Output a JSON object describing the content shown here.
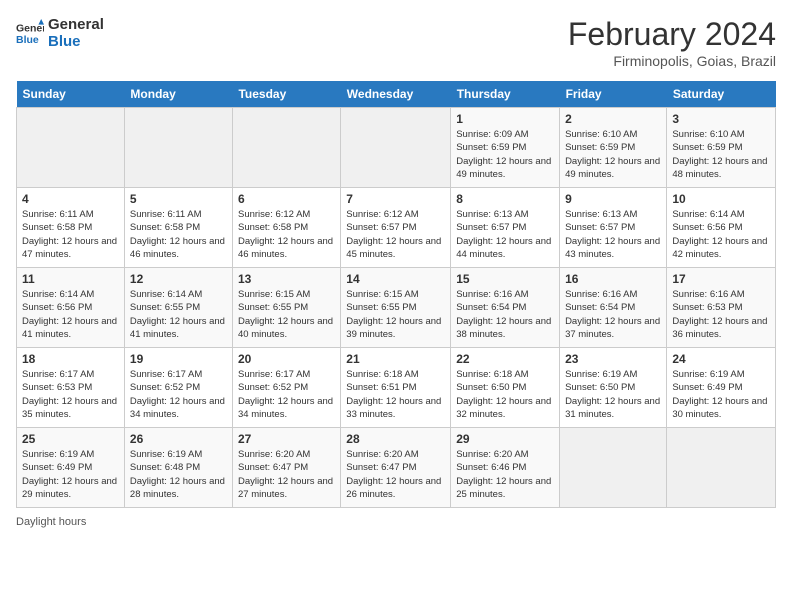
{
  "header": {
    "logo_general": "General",
    "logo_blue": "Blue",
    "month_title": "February 2024",
    "location": "Firminopolis, Goias, Brazil"
  },
  "days_of_week": [
    "Sunday",
    "Monday",
    "Tuesday",
    "Wednesday",
    "Thursday",
    "Friday",
    "Saturday"
  ],
  "weeks": [
    [
      {
        "day": "",
        "sunrise": "",
        "sunset": "",
        "daylight": ""
      },
      {
        "day": "",
        "sunrise": "",
        "sunset": "",
        "daylight": ""
      },
      {
        "day": "",
        "sunrise": "",
        "sunset": "",
        "daylight": ""
      },
      {
        "day": "",
        "sunrise": "",
        "sunset": "",
        "daylight": ""
      },
      {
        "day": "1",
        "sunrise": "Sunrise: 6:09 AM",
        "sunset": "Sunset: 6:59 PM",
        "daylight": "Daylight: 12 hours and 49 minutes."
      },
      {
        "day": "2",
        "sunrise": "Sunrise: 6:10 AM",
        "sunset": "Sunset: 6:59 PM",
        "daylight": "Daylight: 12 hours and 49 minutes."
      },
      {
        "day": "3",
        "sunrise": "Sunrise: 6:10 AM",
        "sunset": "Sunset: 6:59 PM",
        "daylight": "Daylight: 12 hours and 48 minutes."
      }
    ],
    [
      {
        "day": "4",
        "sunrise": "Sunrise: 6:11 AM",
        "sunset": "Sunset: 6:58 PM",
        "daylight": "Daylight: 12 hours and 47 minutes."
      },
      {
        "day": "5",
        "sunrise": "Sunrise: 6:11 AM",
        "sunset": "Sunset: 6:58 PM",
        "daylight": "Daylight: 12 hours and 46 minutes."
      },
      {
        "day": "6",
        "sunrise": "Sunrise: 6:12 AM",
        "sunset": "Sunset: 6:58 PM",
        "daylight": "Daylight: 12 hours and 46 minutes."
      },
      {
        "day": "7",
        "sunrise": "Sunrise: 6:12 AM",
        "sunset": "Sunset: 6:57 PM",
        "daylight": "Daylight: 12 hours and 45 minutes."
      },
      {
        "day": "8",
        "sunrise": "Sunrise: 6:13 AM",
        "sunset": "Sunset: 6:57 PM",
        "daylight": "Daylight: 12 hours and 44 minutes."
      },
      {
        "day": "9",
        "sunrise": "Sunrise: 6:13 AM",
        "sunset": "Sunset: 6:57 PM",
        "daylight": "Daylight: 12 hours and 43 minutes."
      },
      {
        "day": "10",
        "sunrise": "Sunrise: 6:14 AM",
        "sunset": "Sunset: 6:56 PM",
        "daylight": "Daylight: 12 hours and 42 minutes."
      }
    ],
    [
      {
        "day": "11",
        "sunrise": "Sunrise: 6:14 AM",
        "sunset": "Sunset: 6:56 PM",
        "daylight": "Daylight: 12 hours and 41 minutes."
      },
      {
        "day": "12",
        "sunrise": "Sunrise: 6:14 AM",
        "sunset": "Sunset: 6:55 PM",
        "daylight": "Daylight: 12 hours and 41 minutes."
      },
      {
        "day": "13",
        "sunrise": "Sunrise: 6:15 AM",
        "sunset": "Sunset: 6:55 PM",
        "daylight": "Daylight: 12 hours and 40 minutes."
      },
      {
        "day": "14",
        "sunrise": "Sunrise: 6:15 AM",
        "sunset": "Sunset: 6:55 PM",
        "daylight": "Daylight: 12 hours and 39 minutes."
      },
      {
        "day": "15",
        "sunrise": "Sunrise: 6:16 AM",
        "sunset": "Sunset: 6:54 PM",
        "daylight": "Daylight: 12 hours and 38 minutes."
      },
      {
        "day": "16",
        "sunrise": "Sunrise: 6:16 AM",
        "sunset": "Sunset: 6:54 PM",
        "daylight": "Daylight: 12 hours and 37 minutes."
      },
      {
        "day": "17",
        "sunrise": "Sunrise: 6:16 AM",
        "sunset": "Sunset: 6:53 PM",
        "daylight": "Daylight: 12 hours and 36 minutes."
      }
    ],
    [
      {
        "day": "18",
        "sunrise": "Sunrise: 6:17 AM",
        "sunset": "Sunset: 6:53 PM",
        "daylight": "Daylight: 12 hours and 35 minutes."
      },
      {
        "day": "19",
        "sunrise": "Sunrise: 6:17 AM",
        "sunset": "Sunset: 6:52 PM",
        "daylight": "Daylight: 12 hours and 34 minutes."
      },
      {
        "day": "20",
        "sunrise": "Sunrise: 6:17 AM",
        "sunset": "Sunset: 6:52 PM",
        "daylight": "Daylight: 12 hours and 34 minutes."
      },
      {
        "day": "21",
        "sunrise": "Sunrise: 6:18 AM",
        "sunset": "Sunset: 6:51 PM",
        "daylight": "Daylight: 12 hours and 33 minutes."
      },
      {
        "day": "22",
        "sunrise": "Sunrise: 6:18 AM",
        "sunset": "Sunset: 6:50 PM",
        "daylight": "Daylight: 12 hours and 32 minutes."
      },
      {
        "day": "23",
        "sunrise": "Sunrise: 6:19 AM",
        "sunset": "Sunset: 6:50 PM",
        "daylight": "Daylight: 12 hours and 31 minutes."
      },
      {
        "day": "24",
        "sunrise": "Sunrise: 6:19 AM",
        "sunset": "Sunset: 6:49 PM",
        "daylight": "Daylight: 12 hours and 30 minutes."
      }
    ],
    [
      {
        "day": "25",
        "sunrise": "Sunrise: 6:19 AM",
        "sunset": "Sunset: 6:49 PM",
        "daylight": "Daylight: 12 hours and 29 minutes."
      },
      {
        "day": "26",
        "sunrise": "Sunrise: 6:19 AM",
        "sunset": "Sunset: 6:48 PM",
        "daylight": "Daylight: 12 hours and 28 minutes."
      },
      {
        "day": "27",
        "sunrise": "Sunrise: 6:20 AM",
        "sunset": "Sunset: 6:47 PM",
        "daylight": "Daylight: 12 hours and 27 minutes."
      },
      {
        "day": "28",
        "sunrise": "Sunrise: 6:20 AM",
        "sunset": "Sunset: 6:47 PM",
        "daylight": "Daylight: 12 hours and 26 minutes."
      },
      {
        "day": "29",
        "sunrise": "Sunrise: 6:20 AM",
        "sunset": "Sunset: 6:46 PM",
        "daylight": "Daylight: 12 hours and 25 minutes."
      },
      {
        "day": "",
        "sunrise": "",
        "sunset": "",
        "daylight": ""
      },
      {
        "day": "",
        "sunrise": "",
        "sunset": "",
        "daylight": ""
      }
    ]
  ],
  "footer": {
    "note": "Daylight hours"
  }
}
